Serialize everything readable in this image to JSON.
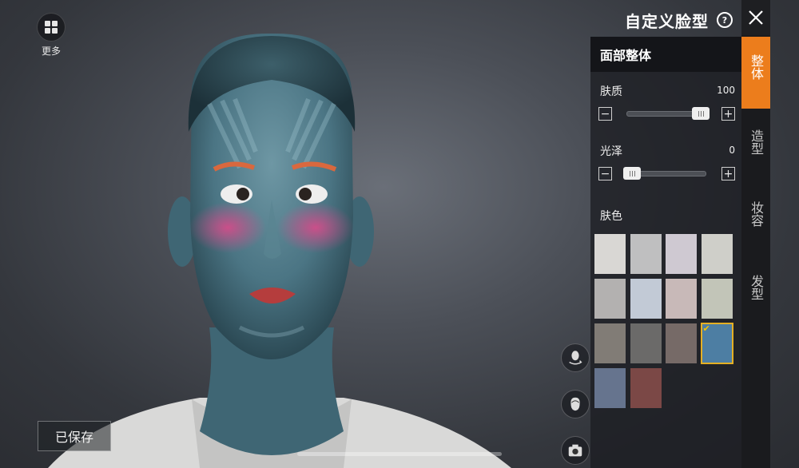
{
  "top_left": {
    "more_label": "更多"
  },
  "footer": {
    "saved_label": "已保存"
  },
  "header": {
    "title": "自定义脸型",
    "help_glyph": "?"
  },
  "side_tabs": [
    {
      "label": "整体",
      "active": true
    },
    {
      "label": "造型",
      "active": false
    },
    {
      "label": "妆容",
      "active": false
    },
    {
      "label": "发型",
      "active": false
    }
  ],
  "panel": {
    "section_title": "面部整体",
    "sliders": [
      {
        "label": "肤质",
        "value": "100",
        "fraction": 1.0,
        "minus": "−",
        "plus": "+"
      },
      {
        "label": "光泽",
        "value": "0",
        "fraction": 0.0,
        "minus": "−",
        "plus": "+"
      }
    ],
    "skin_color_label": "肤色",
    "swatches": [
      "#d9d7d4",
      "#bfbfc0",
      "#cfc9d2",
      "#cfcfc9",
      "#b3b1b0",
      "#c2cad6",
      "#c8b9b8",
      "#c2c5b8",
      "#817c76",
      "#6b6a69",
      "#766a67",
      "#4d7ea3",
      "#66748e",
      "#7b4846"
    ],
    "selected_swatch_index": 11
  },
  "tools": [
    "face-rotate-icon",
    "hair-head-icon",
    "camera-icon"
  ],
  "colors": {
    "accent": "#ec7d1c",
    "selected_outline": "#e5b024",
    "skin": "#4a7383"
  }
}
